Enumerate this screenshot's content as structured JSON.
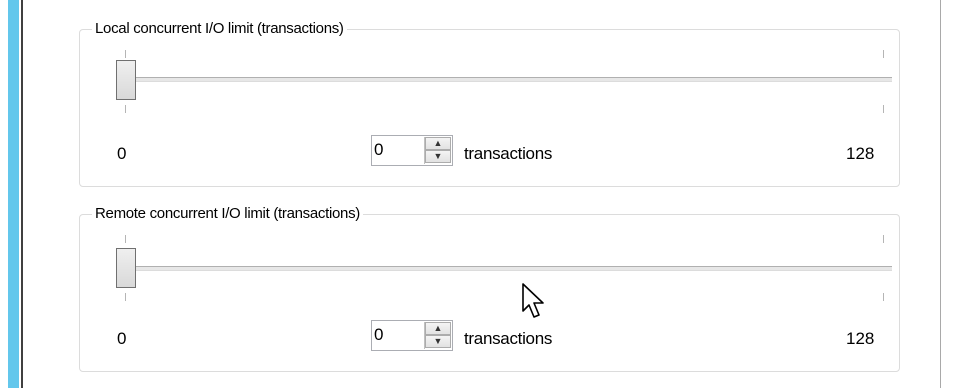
{
  "groups": [
    {
      "title": "Local concurrent I/O limit (transactions)",
      "slider_value": 0,
      "min_label": "0",
      "max_label": "128",
      "spinner_value": "0",
      "units": "transactions"
    },
    {
      "title": "Remote concurrent I/O limit (transactions)",
      "slider_value": 0,
      "min_label": "0",
      "max_label": "128",
      "spinner_value": "0",
      "units": "transactions"
    }
  ],
  "icons": {
    "spin_up": "chevron-up-icon",
    "spin_down": "chevron-down-icon",
    "cursor": "mouse-pointer-icon"
  },
  "colors": {
    "accent": "#63c7ec"
  }
}
